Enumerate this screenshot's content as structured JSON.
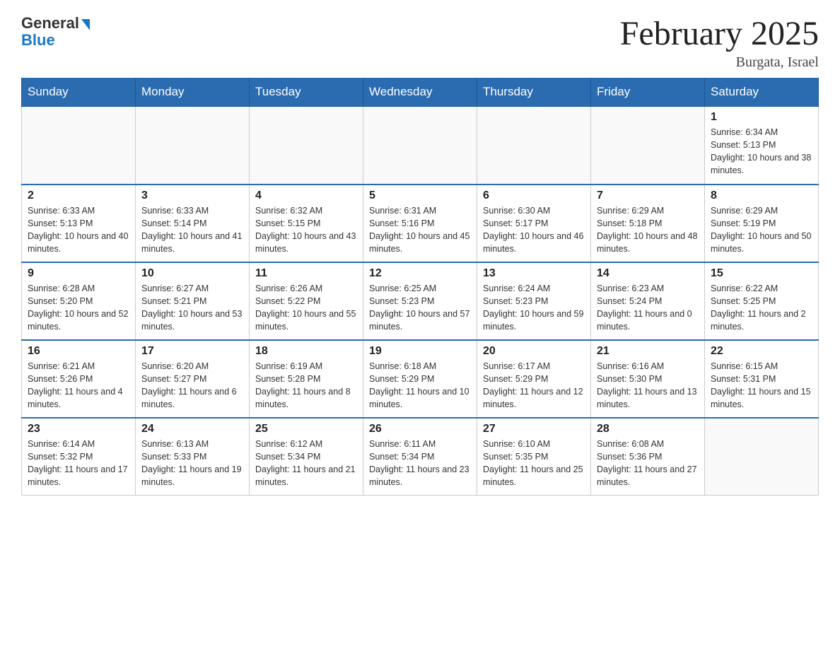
{
  "header": {
    "logo_general": "General",
    "logo_blue": "Blue",
    "month_title": "February 2025",
    "location": "Burgata, Israel"
  },
  "weekdays": [
    "Sunday",
    "Monday",
    "Tuesday",
    "Wednesday",
    "Thursday",
    "Friday",
    "Saturday"
  ],
  "weeks": [
    [
      {
        "day": "",
        "sunrise": "",
        "sunset": "",
        "daylight": ""
      },
      {
        "day": "",
        "sunrise": "",
        "sunset": "",
        "daylight": ""
      },
      {
        "day": "",
        "sunrise": "",
        "sunset": "",
        "daylight": ""
      },
      {
        "day": "",
        "sunrise": "",
        "sunset": "",
        "daylight": ""
      },
      {
        "day": "",
        "sunrise": "",
        "sunset": "",
        "daylight": ""
      },
      {
        "day": "",
        "sunrise": "",
        "sunset": "",
        "daylight": ""
      },
      {
        "day": "1",
        "sunrise": "Sunrise: 6:34 AM",
        "sunset": "Sunset: 5:13 PM",
        "daylight": "Daylight: 10 hours and 38 minutes."
      }
    ],
    [
      {
        "day": "2",
        "sunrise": "Sunrise: 6:33 AM",
        "sunset": "Sunset: 5:13 PM",
        "daylight": "Daylight: 10 hours and 40 minutes."
      },
      {
        "day": "3",
        "sunrise": "Sunrise: 6:33 AM",
        "sunset": "Sunset: 5:14 PM",
        "daylight": "Daylight: 10 hours and 41 minutes."
      },
      {
        "day": "4",
        "sunrise": "Sunrise: 6:32 AM",
        "sunset": "Sunset: 5:15 PM",
        "daylight": "Daylight: 10 hours and 43 minutes."
      },
      {
        "day": "5",
        "sunrise": "Sunrise: 6:31 AM",
        "sunset": "Sunset: 5:16 PM",
        "daylight": "Daylight: 10 hours and 45 minutes."
      },
      {
        "day": "6",
        "sunrise": "Sunrise: 6:30 AM",
        "sunset": "Sunset: 5:17 PM",
        "daylight": "Daylight: 10 hours and 46 minutes."
      },
      {
        "day": "7",
        "sunrise": "Sunrise: 6:29 AM",
        "sunset": "Sunset: 5:18 PM",
        "daylight": "Daylight: 10 hours and 48 minutes."
      },
      {
        "day": "8",
        "sunrise": "Sunrise: 6:29 AM",
        "sunset": "Sunset: 5:19 PM",
        "daylight": "Daylight: 10 hours and 50 minutes."
      }
    ],
    [
      {
        "day": "9",
        "sunrise": "Sunrise: 6:28 AM",
        "sunset": "Sunset: 5:20 PM",
        "daylight": "Daylight: 10 hours and 52 minutes."
      },
      {
        "day": "10",
        "sunrise": "Sunrise: 6:27 AM",
        "sunset": "Sunset: 5:21 PM",
        "daylight": "Daylight: 10 hours and 53 minutes."
      },
      {
        "day": "11",
        "sunrise": "Sunrise: 6:26 AM",
        "sunset": "Sunset: 5:22 PM",
        "daylight": "Daylight: 10 hours and 55 minutes."
      },
      {
        "day": "12",
        "sunrise": "Sunrise: 6:25 AM",
        "sunset": "Sunset: 5:23 PM",
        "daylight": "Daylight: 10 hours and 57 minutes."
      },
      {
        "day": "13",
        "sunrise": "Sunrise: 6:24 AM",
        "sunset": "Sunset: 5:23 PM",
        "daylight": "Daylight: 10 hours and 59 minutes."
      },
      {
        "day": "14",
        "sunrise": "Sunrise: 6:23 AM",
        "sunset": "Sunset: 5:24 PM",
        "daylight": "Daylight: 11 hours and 0 minutes."
      },
      {
        "day": "15",
        "sunrise": "Sunrise: 6:22 AM",
        "sunset": "Sunset: 5:25 PM",
        "daylight": "Daylight: 11 hours and 2 minutes."
      }
    ],
    [
      {
        "day": "16",
        "sunrise": "Sunrise: 6:21 AM",
        "sunset": "Sunset: 5:26 PM",
        "daylight": "Daylight: 11 hours and 4 minutes."
      },
      {
        "day": "17",
        "sunrise": "Sunrise: 6:20 AM",
        "sunset": "Sunset: 5:27 PM",
        "daylight": "Daylight: 11 hours and 6 minutes."
      },
      {
        "day": "18",
        "sunrise": "Sunrise: 6:19 AM",
        "sunset": "Sunset: 5:28 PM",
        "daylight": "Daylight: 11 hours and 8 minutes."
      },
      {
        "day": "19",
        "sunrise": "Sunrise: 6:18 AM",
        "sunset": "Sunset: 5:29 PM",
        "daylight": "Daylight: 11 hours and 10 minutes."
      },
      {
        "day": "20",
        "sunrise": "Sunrise: 6:17 AM",
        "sunset": "Sunset: 5:29 PM",
        "daylight": "Daylight: 11 hours and 12 minutes."
      },
      {
        "day": "21",
        "sunrise": "Sunrise: 6:16 AM",
        "sunset": "Sunset: 5:30 PM",
        "daylight": "Daylight: 11 hours and 13 minutes."
      },
      {
        "day": "22",
        "sunrise": "Sunrise: 6:15 AM",
        "sunset": "Sunset: 5:31 PM",
        "daylight": "Daylight: 11 hours and 15 minutes."
      }
    ],
    [
      {
        "day": "23",
        "sunrise": "Sunrise: 6:14 AM",
        "sunset": "Sunset: 5:32 PM",
        "daylight": "Daylight: 11 hours and 17 minutes."
      },
      {
        "day": "24",
        "sunrise": "Sunrise: 6:13 AM",
        "sunset": "Sunset: 5:33 PM",
        "daylight": "Daylight: 11 hours and 19 minutes."
      },
      {
        "day": "25",
        "sunrise": "Sunrise: 6:12 AM",
        "sunset": "Sunset: 5:34 PM",
        "daylight": "Daylight: 11 hours and 21 minutes."
      },
      {
        "day": "26",
        "sunrise": "Sunrise: 6:11 AM",
        "sunset": "Sunset: 5:34 PM",
        "daylight": "Daylight: 11 hours and 23 minutes."
      },
      {
        "day": "27",
        "sunrise": "Sunrise: 6:10 AM",
        "sunset": "Sunset: 5:35 PM",
        "daylight": "Daylight: 11 hours and 25 minutes."
      },
      {
        "day": "28",
        "sunrise": "Sunrise: 6:08 AM",
        "sunset": "Sunset: 5:36 PM",
        "daylight": "Daylight: 11 hours and 27 minutes."
      },
      {
        "day": "",
        "sunrise": "",
        "sunset": "",
        "daylight": ""
      }
    ]
  ]
}
